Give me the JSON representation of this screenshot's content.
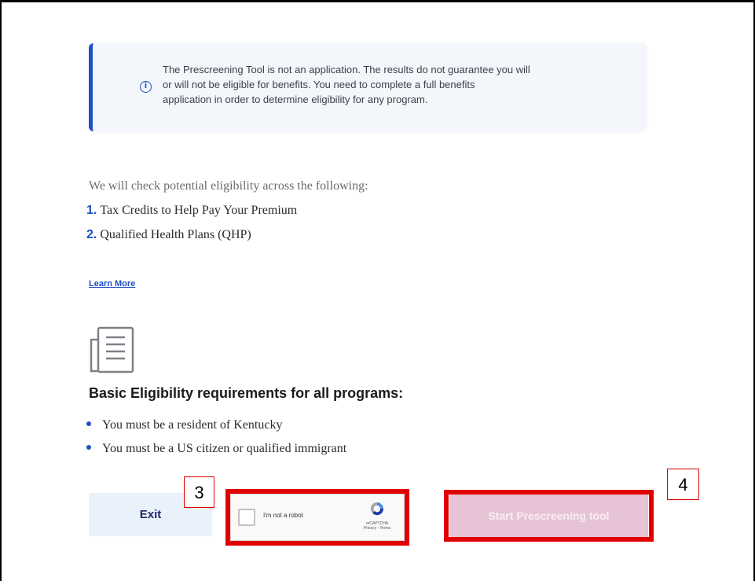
{
  "notice": {
    "icon": "info-circle-icon",
    "lines": [
      "The Prescreening Tool is not an application. The results do not guarantee you will",
      "or will not be eligible for benefits. You need to complete a full benefits",
      "application in order to determine eligibility for any program."
    ]
  },
  "eligibility": {
    "intro": "We will check potential eligibility across the following:",
    "programs": [
      {
        "num": "1.",
        "label": "Tax Credits to Help Pay Your Premium"
      },
      {
        "num": "2.",
        "label": "Qualified Health Plans (QHP)"
      }
    ],
    "learn_more": "Learn More"
  },
  "requirements": {
    "icon": "document-icon",
    "title": "Basic Eligibility requirements for all programs:",
    "items": [
      "You must be a resident of Kentucky",
      "You must be a US citizen or qualified immigrant"
    ]
  },
  "actions": {
    "exit_label": "Exit",
    "captcha_label": "I'm not a robot",
    "captcha_brand": "reCAPTCHA",
    "captcha_links": "Privacy - Terms",
    "start_label": "Start Prescreening tool"
  },
  "markers": {
    "m3": "3",
    "m4": "4"
  },
  "colors": {
    "accent": "#1f4fc4",
    "highlight": "#e00000",
    "start_disabled": "#e6c3d6"
  }
}
